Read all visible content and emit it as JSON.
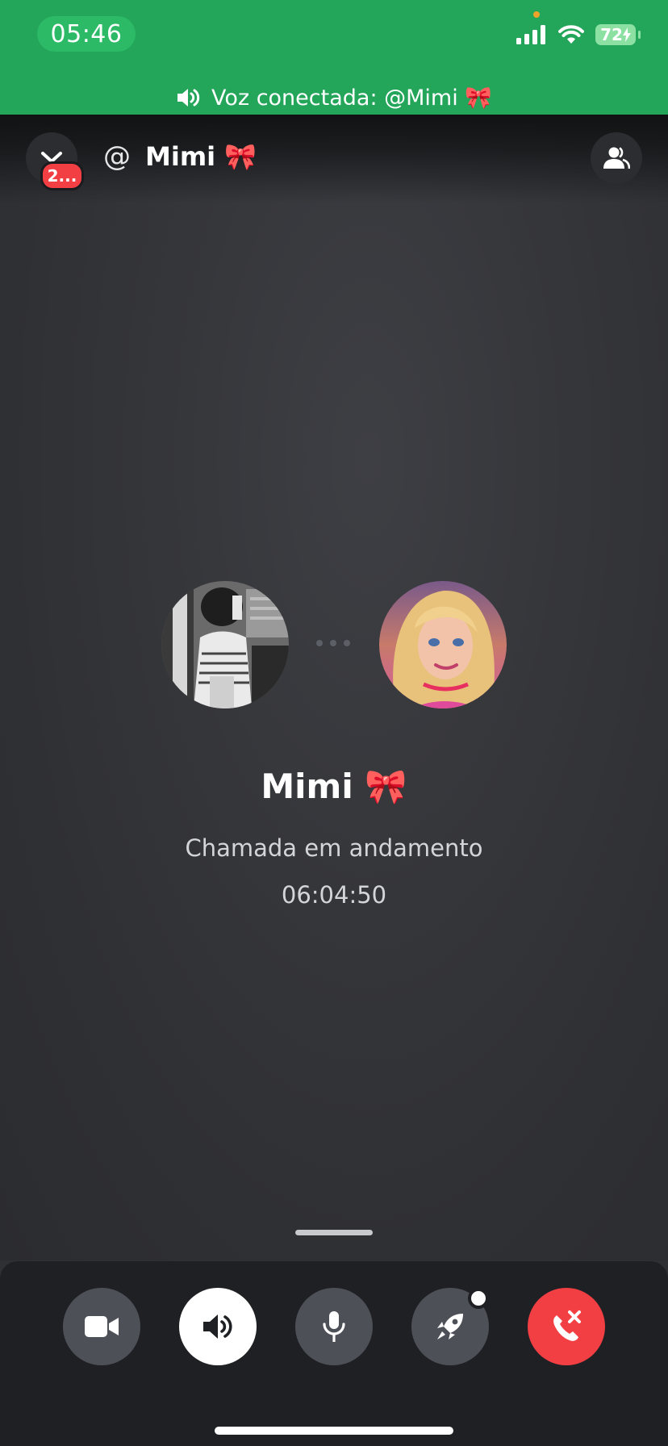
{
  "status_bar": {
    "time": "05:46",
    "battery": "72"
  },
  "voice_banner": {
    "text": "Voz conectada: @Mimi 🎀"
  },
  "header": {
    "at_symbol": "@",
    "title": "Mimi 🎀",
    "badge": "2..."
  },
  "call": {
    "name": "Mimi 🎀",
    "status": "Chamada em andamento",
    "timer": "06:04:50"
  },
  "controls": {
    "video": "video-camera-icon",
    "speaker": "speaker-icon",
    "mic": "microphone-icon",
    "activity": "rocket-icon",
    "end": "end-call-icon"
  },
  "colors": {
    "connected_green": "#23a55a",
    "end_call_red": "#f23f43",
    "badge_red": "#f23f43",
    "background": "#2f3034"
  }
}
